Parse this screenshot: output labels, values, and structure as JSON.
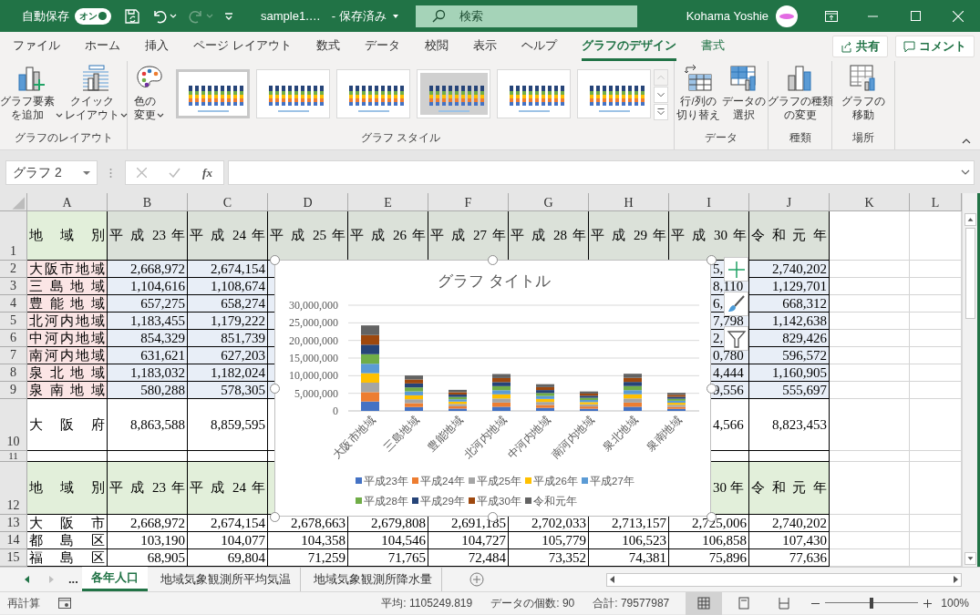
{
  "title_bar": {
    "autosave_label": "自動保存",
    "autosave_toggle": {
      "text": "オン",
      "on": true
    },
    "redo_disabled": true,
    "file_name": "sample1.…",
    "save_state": "- 保存済み",
    "search_placeholder": "検索",
    "user_name": "Kohama Yoshie"
  },
  "ribbon_tabs": [
    {
      "label": "ファイル",
      "selected": false,
      "kind": "normal"
    },
    {
      "label": "ホーム",
      "selected": false,
      "kind": "normal"
    },
    {
      "label": "挿入",
      "selected": false,
      "kind": "normal"
    },
    {
      "label": "ページ レイアウト",
      "selected": false,
      "kind": "normal"
    },
    {
      "label": "数式",
      "selected": false,
      "kind": "normal"
    },
    {
      "label": "データ",
      "selected": false,
      "kind": "normal"
    },
    {
      "label": "校閲",
      "selected": false,
      "kind": "normal"
    },
    {
      "label": "表示",
      "selected": false,
      "kind": "normal"
    },
    {
      "label": "ヘルプ",
      "selected": false,
      "kind": "normal"
    },
    {
      "label": "グラフのデザイン",
      "selected": true,
      "kind": "contextual"
    },
    {
      "label": "書式",
      "selected": false,
      "kind": "contextual"
    }
  ],
  "share_button": "共有",
  "comment_button": "コメント",
  "ribbon_groups": [
    {
      "label": "グラフのレイアウト",
      "buttons": [
        {
          "label": [
            "グラフ要素",
            "を追加"
          ],
          "dropdown": true
        },
        {
          "label": [
            "クイック",
            "レイアウト"
          ],
          "dropdown": true
        }
      ]
    },
    {
      "label": "グラフ スタイル",
      "buttons": [
        {
          "label": [
            "色の",
            "変更"
          ],
          "dropdown": true
        }
      ],
      "gallery": [
        {
          "selected": true
        },
        {
          "selected": false
        },
        {
          "selected": false
        },
        {
          "selected": false
        },
        {
          "selected": false
        },
        {
          "selected": false
        }
      ]
    },
    {
      "label": "データ",
      "buttons": [
        {
          "label": [
            "行/列の",
            "切り替え"
          ],
          "dropdown": false
        },
        {
          "label": [
            "データの",
            "選択"
          ],
          "dropdown": false
        }
      ]
    },
    {
      "label": "種類",
      "buttons": [
        {
          "label": [
            "グラフの種類",
            "の変更"
          ],
          "dropdown": false
        }
      ]
    },
    {
      "label": "場所",
      "buttons": [
        {
          "label": [
            "グラフの",
            "移動"
          ],
          "dropdown": false
        }
      ]
    }
  ],
  "formula_bar": {
    "name_box": "グラフ 2",
    "insert_function": "fx"
  },
  "sheet": {
    "columns": [
      "A",
      "B",
      "C",
      "D",
      "E",
      "F",
      "G",
      "H",
      "I",
      "J",
      "K",
      "L"
    ],
    "rows": [
      {
        "number": "1",
        "kind": "series-header",
        "cells": {
          "A": "地 域 別",
          "B": "平 成 23 年",
          "C": "平 成 24 年",
          "D": "平 成 25 年",
          "E": "平 成 26 年",
          "F": "平 成 27 年",
          "G": "平 成 28 年",
          "H": "平 成 29 年",
          "I": "平 成 30 年",
          "J": "令 和 元 年"
        }
      },
      {
        "number": "2",
        "kind": "data",
        "cells": {
          "A": "大阪市地域",
          "B": "2,668,972",
          "C": "2,674,154",
          "I": "5,",
          "J": "2,740,202"
        }
      },
      {
        "number": "3",
        "kind": "data",
        "cells": {
          "A": "三 島 地 域",
          "B": "1,104,616",
          "C": "1,108,674",
          "I": "8,110",
          "J": "1,129,701"
        }
      },
      {
        "number": "4",
        "kind": "data",
        "cells": {
          "A": "豊 能 地 域",
          "B": "657,275",
          "C": "658,274",
          "I": "6,",
          "J": "668,312"
        }
      },
      {
        "number": "5",
        "kind": "data",
        "cells": {
          "A": "北河内地域",
          "B": "1,183,455",
          "C": "1,179,222",
          "I": "7,798",
          "J": "1,142,638"
        }
      },
      {
        "number": "6",
        "kind": "data",
        "cells": {
          "A": "中河内地域",
          "B": "854,329",
          "C": "851,739",
          "I": "2,",
          "J": "829,426"
        }
      },
      {
        "number": "7",
        "kind": "data",
        "cells": {
          "A": "南河内地域",
          "B": "631,621",
          "C": "627,203",
          "I": "0,780",
          "J": "596,572"
        }
      },
      {
        "number": "8",
        "kind": "data",
        "cells": {
          "A": "泉 北 地 域",
          "B": "1,183,032",
          "C": "1,182,024",
          "I": "4,444",
          "J": "1,160,905"
        }
      },
      {
        "number": "9",
        "kind": "data",
        "cells": {
          "A": "泉 南 地 域",
          "B": "580,288",
          "C": "578,305",
          "I": "9,556",
          "J": "555,697"
        }
      },
      {
        "number": "10",
        "kind": "total",
        "cells": {
          "A": "大 阪 府",
          "B": "8,863,588",
          "C": "8,859,595",
          "I": "4,566",
          "J": "8,823,453"
        }
      },
      {
        "number": "11",
        "kind": "blank"
      },
      {
        "number": "12",
        "kind": "header",
        "cells": {
          "A": "地 域 別",
          "B": "平 成 23 年",
          "C": "平 成 24 年",
          "I": "30 年",
          "J": "令 和 元 年"
        }
      },
      {
        "number": "13",
        "kind": "plain",
        "cells": {
          "A": "大 阪 市",
          "B": "2,668,972",
          "C": "2,674,154",
          "D": "2,678,663",
          "E": "2,679,808",
          "F": "2,691,185",
          "G": "2,702,033",
          "H": "2,713,157",
          "I": "2,725,006",
          "J": "2,740,202"
        }
      },
      {
        "number": "14",
        "kind": "plain",
        "cells": {
          "A": "都 島 区",
          "B": "103,190",
          "C": "104,077",
          "D": "104,358",
          "E": "104,546",
          "F": "104,727",
          "G": "105,779",
          "H": "106,523",
          "I": "106,858",
          "J": "107,430"
        }
      },
      {
        "number": "15",
        "kind": "plain",
        "cells": {
          "A": "福 島 区",
          "B": "68,905",
          "C": "69,804",
          "D": "71,259",
          "E": "71,765",
          "F": "72,484",
          "G": "73,352",
          "H": "74,381",
          "I": "75,896",
          "J": "77,636"
        }
      }
    ]
  },
  "chart": {
    "chart_data": {
      "type": "bar",
      "stacked": true,
      "orientation": "vertical",
      "grid": true,
      "legend": true,
      "title": "グラフ タイトル",
      "categories": [
        "大阪市地域",
        "三島地域",
        "豊能地域",
        "北河内地域",
        "中河内地域",
        "南河内地域",
        "泉北地域",
        "泉南地域"
      ],
      "ylim": [
        0,
        30000000
      ],
      "yticks": [
        {
          "value": 0,
          "label": "0"
        },
        {
          "value": 5000000,
          "label": "5,000,000"
        },
        {
          "value": 10000000,
          "label": "10,000,000"
        },
        {
          "value": 15000000,
          "label": "15,000,000"
        },
        {
          "value": 20000000,
          "label": "20,000,000"
        },
        {
          "value": 25000000,
          "label": "25,000,000"
        },
        {
          "value": 30000000,
          "label": "30,000,000"
        }
      ],
      "series": [
        {
          "name": "平成23年",
          "color": "#4472c4",
          "values": [
            2670000,
            1100000,
            660000,
            1180000,
            850000,
            630000,
            1180000,
            580000
          ]
        },
        {
          "name": "平成24年",
          "color": "#ed7d31",
          "values": [
            2670000,
            1110000,
            660000,
            1180000,
            850000,
            630000,
            1180000,
            580000
          ]
        },
        {
          "name": "平成25年",
          "color": "#a5a5a5",
          "values": [
            2680000,
            1110000,
            660000,
            1180000,
            850000,
            620000,
            1180000,
            580000
          ]
        },
        {
          "name": "平成26年",
          "color": "#ffc000",
          "values": [
            2680000,
            1110000,
            660000,
            1170000,
            850000,
            620000,
            1180000,
            570000
          ]
        },
        {
          "name": "平成27年",
          "color": "#5b9bd5",
          "values": [
            2690000,
            1120000,
            660000,
            1160000,
            840000,
            610000,
            1170000,
            570000
          ]
        },
        {
          "name": "平成28年",
          "color": "#70ad47",
          "values": [
            2700000,
            1120000,
            670000,
            1160000,
            840000,
            610000,
            1170000,
            570000
          ]
        },
        {
          "name": "平成29年",
          "color": "#264478",
          "values": [
            2710000,
            1130000,
            670000,
            1150000,
            840000,
            600000,
            1170000,
            560000
          ]
        },
        {
          "name": "平成30年",
          "color": "#9e480e",
          "values": [
            2730000,
            1130000,
            670000,
            1150000,
            830000,
            600000,
            1160000,
            560000
          ]
        },
        {
          "name": "令和元年",
          "color": "#636363",
          "values": [
            2740000,
            1130000,
            670000,
            1140000,
            830000,
            600000,
            1160000,
            560000
          ]
        }
      ]
    }
  },
  "sheet_tabs": {
    "more": "...",
    "tabs": [
      {
        "label": "各年人口",
        "selected": true
      },
      {
        "label": "地域気象観測所平均気温",
        "selected": false
      },
      {
        "label": "地域気象観測所降水量",
        "selected": false
      }
    ]
  },
  "status_bar": {
    "mode": "再計算",
    "average": "平均: 1105249.819",
    "count": "データの個数: 90",
    "sum": "合計: 79577987",
    "views": [
      {
        "selected": true
      },
      {
        "selected": false
      },
      {
        "selected": false
      }
    ],
    "zoom": {
      "level": 0.5,
      "text": "100%"
    }
  }
}
